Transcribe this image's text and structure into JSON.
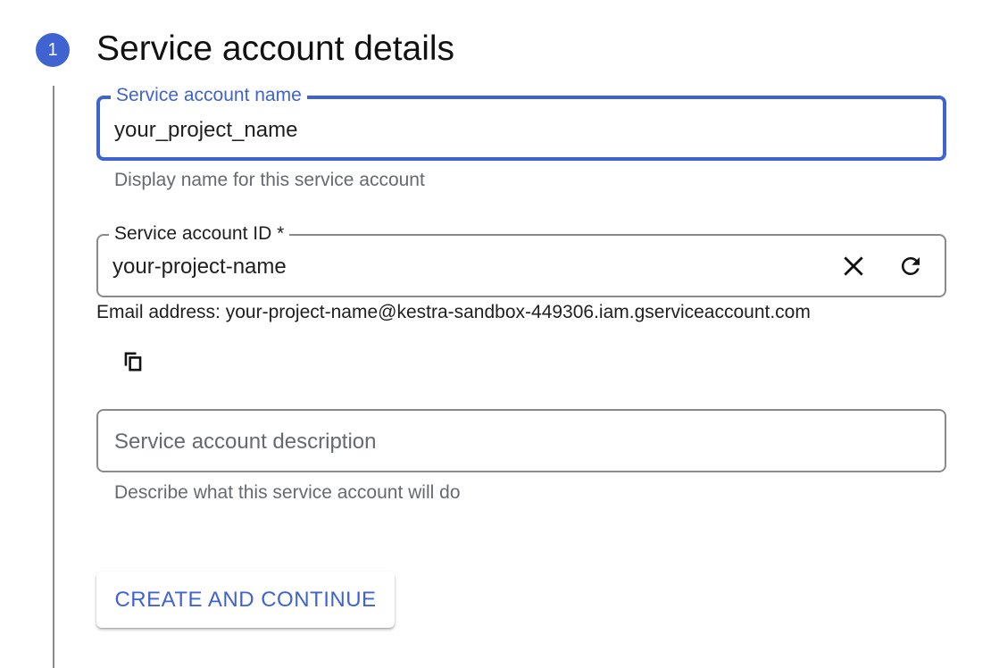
{
  "step": {
    "number": "1",
    "title": "Service account details"
  },
  "name_field": {
    "label": "Service account name",
    "value": "your_project_name",
    "helper": "Display name for this service account",
    "focused": true
  },
  "id_field": {
    "label": "Service account ID *",
    "value": "your-project-name",
    "clear_icon": "close-icon",
    "refresh_icon": "refresh-icon"
  },
  "email": {
    "text": "Email address: your-project-name@kestra-sandbox-449306.iam.gserviceaccount.com",
    "copy_icon": "copy-icon"
  },
  "description_field": {
    "placeholder": "Service account description",
    "helper": "Describe what this service account will do"
  },
  "actions": {
    "primary_label": "CREATE AND CONTINUE"
  },
  "colors": {
    "accent": "#3f63d1",
    "border": "#8a8a8a",
    "helper_text": "#666a6f"
  }
}
